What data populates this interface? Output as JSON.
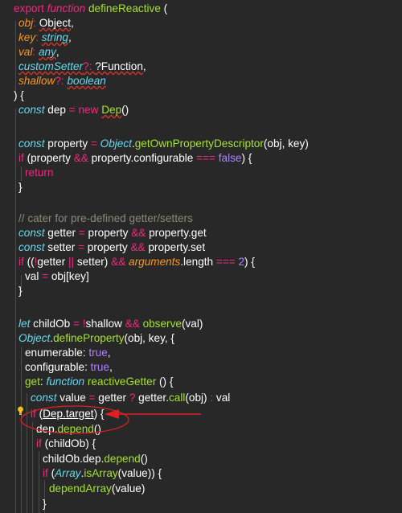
{
  "code": {
    "l01": {
      "a": "export ",
      "b": "function ",
      "c": "defineReactive",
      "d": " ("
    },
    "l02": {
      "a": "obj",
      "b": ": ",
      "c": "Object",
      "d": ","
    },
    "l03": {
      "a": "key",
      "b": ": ",
      "c": "string",
      "d": ","
    },
    "l04": {
      "a": "val",
      "b": ": ",
      "c": "any",
      "d": ","
    },
    "l05": {
      "a": "customSetter",
      "b": "?: ",
      "c": "?Function",
      "d": ","
    },
    "l06": {
      "a": "shallow",
      "b": "?: ",
      "c": "boolean"
    },
    "l07": {
      "a": ") {"
    },
    "l08": {
      "a": "const ",
      "b": "dep ",
      "c": "= ",
      "d": "new ",
      "e": "Dep",
      "f": "()"
    },
    "l09": {
      "a": "const ",
      "b": "property ",
      "c": "= ",
      "d": "Object",
      ".": ".",
      "e": "getOwnPropertyDescriptor",
      "f": "(obj, key)"
    },
    "l10": {
      "a": "if ",
      "b": "(property ",
      "c": "&& ",
      "d": "property.configurable ",
      "e": "=== ",
      "f": "false",
      ")": ") {"
    },
    "l11": {
      "a": "return"
    },
    "l12": {
      "a": "}"
    },
    "l13": {
      "a": "// cater for pre-defined getter/setters"
    },
    "l14": {
      "a": "const ",
      "b": "getter ",
      "c": "= ",
      "d": "property ",
      "e": "&& ",
      "f": "property.get"
    },
    "l15": {
      "a": "const ",
      "b": "setter ",
      "c": "= ",
      "d": "property ",
      "e": "&& ",
      "f": "property.set"
    },
    "l16": {
      "a": "if ",
      "b": "((",
      "c": "!",
      "d": "getter ",
      "e": "|| ",
      "f": "setter) ",
      "g": "&& ",
      "h": "arguments",
      ".": ".length ",
      "i": "=== ",
      "j": "2",
      ")": ") {"
    },
    "l17": {
      "a": "val ",
      "b": "= ",
      "c": "obj[key]"
    },
    "l18": {
      "a": "}"
    },
    "l19": {
      "a": "let ",
      "b": "childOb ",
      "c": "= ",
      "d": "!",
      "e": "shallow ",
      "f": "&& ",
      "g": "observe",
      "h": "(val)"
    },
    "l20": {
      "a": "Object",
      ".": ".",
      "b": "defineProperty",
      "c": "(obj, key, {"
    },
    "l21": {
      "a": "enumerable",
      "b": ": ",
      "c": "true",
      ",": ","
    },
    "l22": {
      "a": "configurable",
      "b": ": ",
      "c": "true",
      ",": ","
    },
    "l23": {
      "a": "get",
      "b": ": ",
      "c": "function ",
      "d": "reactiveGetter ",
      "e": "() {"
    },
    "l24": {
      "a": "const ",
      "b": "value ",
      "c": "= ",
      "d": "getter ",
      "e": "? ",
      "f": "getter",
      ".": ".",
      "g": "call",
      "h": "(obj) ",
      "i": ": ",
      "j": "val"
    },
    "l25": {
      "a": "if ",
      "b": "(",
      "c": "Dep.target",
      ")": ") {"
    },
    "l26": {
      "a": "dep",
      ".": ".",
      "b": "depend",
      "c": "()"
    },
    "l27": {
      "a": "if ",
      "b": "(childOb) {"
    },
    "l28": {
      "a": "childOb.dep",
      ".": ".",
      "b": "depend",
      "c": "()"
    },
    "l29": {
      "a": "if ",
      "b": "(",
      "c": "Array",
      ".": ".",
      "d": "isArray",
      "e": "(value)) {"
    },
    "l30": {
      "a": "dependArray",
      "b": "(value)"
    },
    "l31": {
      "a": "}"
    }
  },
  "colors": {
    "background": "#282828",
    "keyword": "#f1297e",
    "type": "#66d9ef",
    "function": "#a6e22e",
    "param": "#fd971f",
    "number": "#ae81ff",
    "comment": "#8a8a7a",
    "annotation": "#e02020"
  },
  "icons": {
    "gutter": "lightbulb-icon"
  }
}
